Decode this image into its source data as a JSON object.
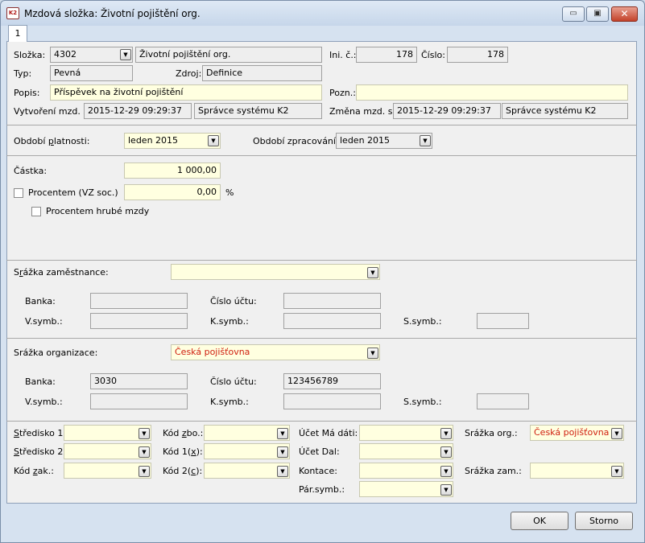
{
  "window": {
    "title": "Mzdová složka: Životní pojištění org.",
    "app_icon_text": "K2",
    "minimize": "▭",
    "maximize": "▣",
    "close": "✕"
  },
  "tabs": [
    "1"
  ],
  "header": {
    "slozka_label": "Složka:",
    "slozka_value": "4302",
    "slozka_name": "Životní pojištění org.",
    "ini_label": "Ini. č.:",
    "ini_value": "178",
    "cislo_label": "Číslo:",
    "cislo_value": "178",
    "typ_label": "Typ:",
    "typ_value": "Pevná",
    "zdroj_label": "Zdroj:",
    "zdroj_value": "Definice",
    "popis_label": "Popis:",
    "popis_value": "Příspěvek na životní pojištění",
    "pozn_label": "Pozn.:",
    "pozn_value": "",
    "vytvoreni_label": "Vytvoření mzd. sl:",
    "vytvoreni_date": "2015-12-29 09:29:37",
    "vytvoreni_user": "Správce systému K2",
    "zmena_label": "Změna mzd. sl:",
    "zmena_date": "2015-12-29 09:29:37",
    "zmena_user": "Správce systému K2"
  },
  "period": {
    "platnosti_label_a": "Období ",
    "platnosti_label_u": "p",
    "platnosti_label_b": "latnosti:",
    "platnosti_value": "leden 2015",
    "zpracovani_label": "Období zpracování:",
    "zpracovani_value": "leden 2015"
  },
  "amount": {
    "castka_label": "Částka:",
    "castka_value": "1 000,00",
    "procentem_label": "Procentem (VZ soc.)",
    "procentem_value": "0,00",
    "percent_sign": "%",
    "hrube_label": "Procentem hrubé mzdy"
  },
  "srazka_zam": {
    "label_a": "S",
    "label_u": "r",
    "label_b": "ážka zaměstnance:",
    "value": "",
    "banka_label": "Banka:",
    "banka_value": "",
    "ucet_label": "Číslo účtu:",
    "ucet_value": "",
    "vsymb_label": "V.symb.:",
    "vsymb_value": "",
    "ksymb_label": "K.symb.:",
    "ksymb_value": "",
    "ssymb_label": "S.symb.:",
    "ssymb_value": ""
  },
  "srazka_org": {
    "label": "Srážka organizace:",
    "value": "Česká pojišťovna",
    "banka_label": "Banka:",
    "banka_value": "3030",
    "ucet_label": "Číslo účtu:",
    "ucet_value": "123456789",
    "vsymb_label": "V.symb.:",
    "vsymb_value": "",
    "ksymb_label": "K.symb.:",
    "ksymb_value": "",
    "ssymb_label": "S.symb.:",
    "ssymb_value": ""
  },
  "accounting": {
    "stredisko1_u": "S",
    "stredisko1_b": "tředisko 1:",
    "stredisko2_u": "S",
    "stredisko2_b": "tředisko 2:",
    "kodzak_a": "Kód ",
    "kodzak_u": "z",
    "kodzak_b": "ak.:",
    "kodzbo_a": "Kód ",
    "kodzbo_u": "z",
    "kodzbo_b": "bo.:",
    "kod1_a": "Kód 1(",
    "kod1_u": "x",
    "kod1_b": "):",
    "kod2_a": "Kód 2(",
    "kod2_u": "c",
    "kod2_b": "):",
    "ucet_ma_dati": "Účet Má dáti:",
    "ucet_dal": "Účet Dal:",
    "kontace": "Kontace:",
    "par_symb": "Pár.symb.:",
    "srazka_org_label": "Srážka org.:",
    "srazka_org_value": "Česká pojišťovna",
    "srazka_zam_label": "Srážka zam.:",
    "srazka_zam_value": ""
  },
  "buttons": {
    "ok": "OK",
    "storno": "Storno"
  },
  "dropdown_arrow": "▼",
  "colors": {
    "required_field": "#ffffe0",
    "readonly_field": "#eeeeee",
    "highlight_text": "#d02010"
  }
}
